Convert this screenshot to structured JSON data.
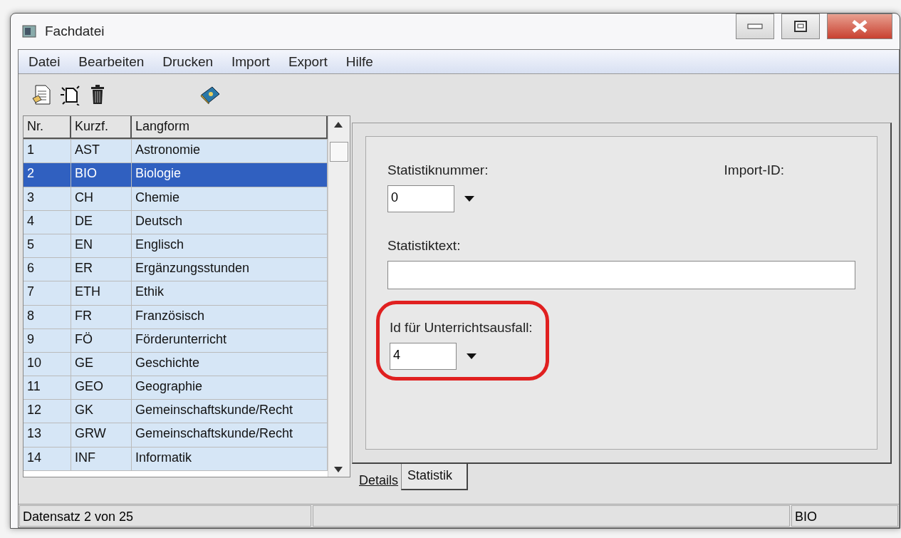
{
  "window": {
    "title": "Fachdatei"
  },
  "menu": [
    "Datei",
    "Bearbeiten",
    "Drucken",
    "Import",
    "Export",
    "Hilfe"
  ],
  "table": {
    "columns": [
      "Nr.",
      "Kurzf.",
      "Langform"
    ],
    "rows": [
      {
        "cells": [
          "1",
          "AST",
          "Astronomie"
        ],
        "selected": false
      },
      {
        "cells": [
          "2",
          "BIO",
          "Biologie"
        ],
        "selected": true
      },
      {
        "cells": [
          "3",
          "CH",
          "Chemie"
        ],
        "selected": false
      },
      {
        "cells": [
          "4",
          "DE",
          "Deutsch"
        ],
        "selected": false
      },
      {
        "cells": [
          "5",
          "EN",
          "Englisch"
        ],
        "selected": false
      },
      {
        "cells": [
          "6",
          "ER",
          "Ergänzungsstunden"
        ],
        "selected": false
      },
      {
        "cells": [
          "7",
          "ETH",
          "Ethik"
        ],
        "selected": false
      },
      {
        "cells": [
          "8",
          "FR",
          "Französisch"
        ],
        "selected": false
      },
      {
        "cells": [
          "9",
          "FÖ",
          "Förderunterricht"
        ],
        "selected": false
      },
      {
        "cells": [
          "10",
          "GE",
          "Geschichte"
        ],
        "selected": false
      },
      {
        "cells": [
          "11",
          "GEO",
          "Geographie"
        ],
        "selected": false
      },
      {
        "cells": [
          "12",
          "GK",
          "Gemeinschaftskunde/Recht"
        ],
        "selected": false
      },
      {
        "cells": [
          "13",
          "GRW",
          "Gemeinschaftskunde/Recht"
        ],
        "selected": false
      },
      {
        "cells": [
          "14",
          "INF",
          "Informatik"
        ],
        "selected": false
      }
    ]
  },
  "form": {
    "statistiknummer": {
      "label": "Statistiknummer:",
      "value": "0"
    },
    "import_id": {
      "label": "Import-ID:"
    },
    "statistiktext": {
      "label": "Statistiktext:"
    },
    "ausfall": {
      "label": "Id für Unterrichtsausfall:",
      "value": "4",
      "highlighted": true
    }
  },
  "tabs": [
    {
      "label": "Details",
      "selected": false
    },
    {
      "label": "Statistik",
      "selected": true
    }
  ],
  "status_bar": {
    "record": "Datensatz 2 von 25",
    "code": "BIO"
  }
}
